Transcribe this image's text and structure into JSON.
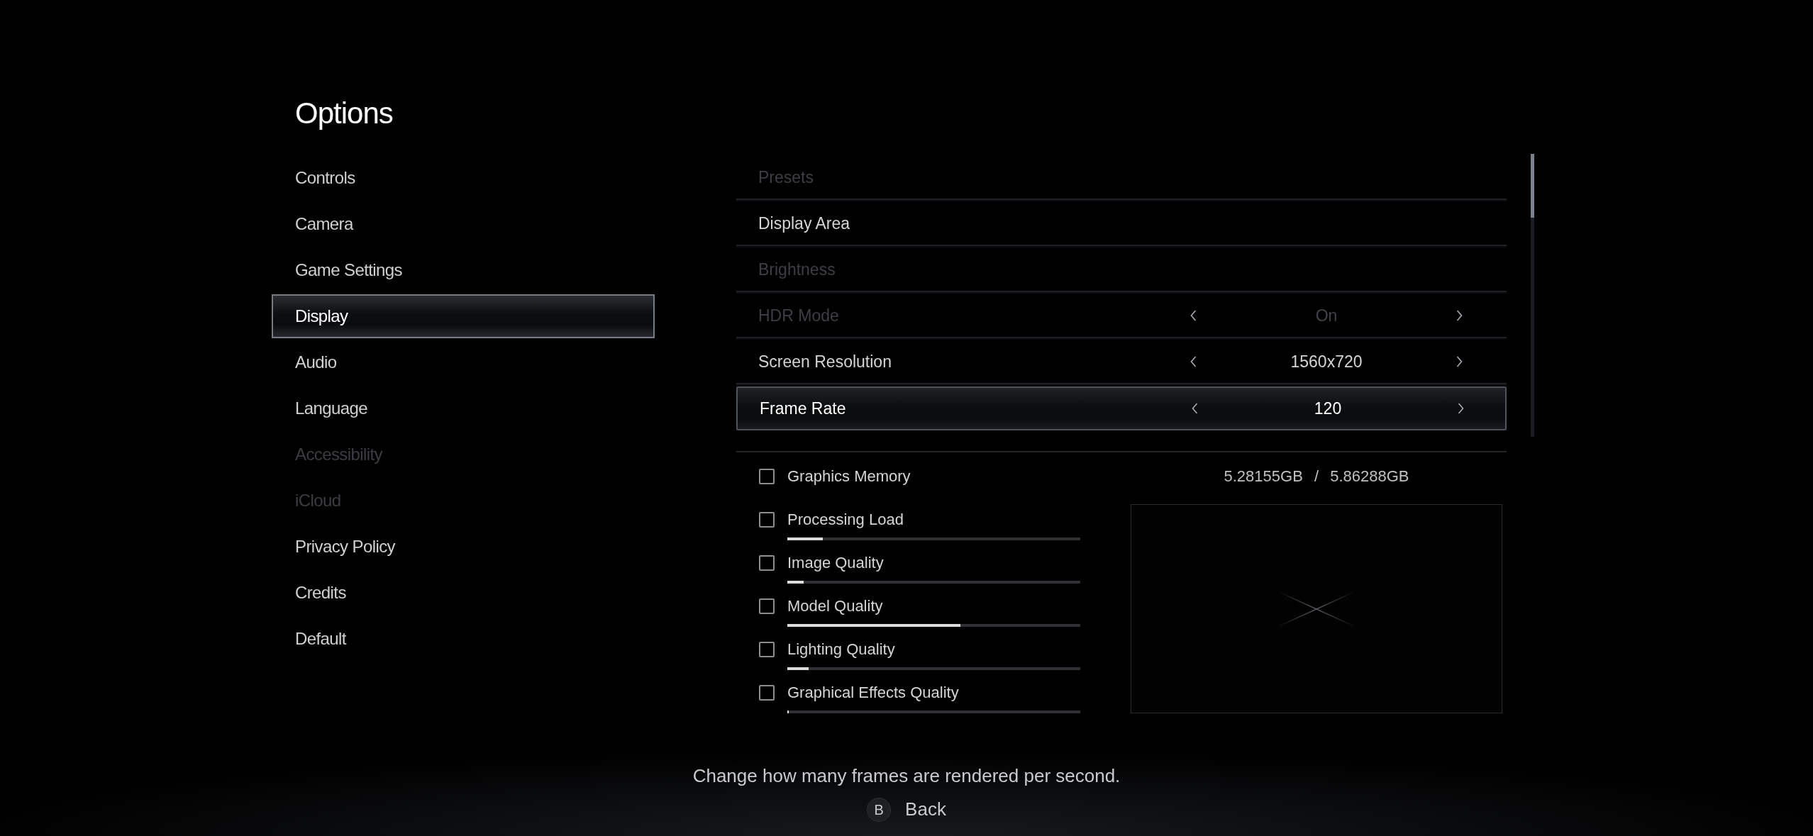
{
  "title": "Options",
  "menu": [
    {
      "label": "Controls",
      "selected": false,
      "disabled": false
    },
    {
      "label": "Camera",
      "selected": false,
      "disabled": false
    },
    {
      "label": "Game Settings",
      "selected": false,
      "disabled": false
    },
    {
      "label": "Display",
      "selected": true,
      "disabled": false
    },
    {
      "label": "Audio",
      "selected": false,
      "disabled": false
    },
    {
      "label": "Language",
      "selected": false,
      "disabled": false
    },
    {
      "label": "Accessibility",
      "selected": false,
      "disabled": true
    },
    {
      "label": "iCloud",
      "selected": false,
      "disabled": true
    },
    {
      "label": "Privacy Policy",
      "selected": false,
      "disabled": false
    },
    {
      "label": "Credits",
      "selected": false,
      "disabled": false
    },
    {
      "label": "Default",
      "selected": false,
      "disabled": false
    }
  ],
  "settings": [
    {
      "kind": "link",
      "label": "Presets",
      "selected": false,
      "disabled": true
    },
    {
      "kind": "link",
      "label": "Display Area",
      "selected": false,
      "disabled": false
    },
    {
      "kind": "link",
      "label": "Brightness",
      "selected": false,
      "disabled": true
    },
    {
      "kind": "selector",
      "label": "HDR Mode",
      "value": "On",
      "selected": false,
      "disabled": true
    },
    {
      "kind": "selector",
      "label": "Screen Resolution",
      "value": "1560x720",
      "selected": false,
      "disabled": false
    },
    {
      "kind": "selector",
      "label": "Frame Rate",
      "value": "120",
      "selected": true,
      "disabled": false
    }
  ],
  "monitor": {
    "items": [
      {
        "kind": "reading",
        "label": "Graphics Memory",
        "checked": false,
        "value": "5.28155GB / 5.86288GB"
      },
      {
        "kind": "meter",
        "label": "Processing Load",
        "checked": false,
        "level": 0.12
      },
      {
        "kind": "meter",
        "label": "Image Quality",
        "checked": false,
        "level": 0.056
      },
      {
        "kind": "meter",
        "label": "Model Quality",
        "checked": false,
        "level": 0.59
      },
      {
        "kind": "meter",
        "label": "Lighting Quality",
        "checked": false,
        "level": 0.073
      },
      {
        "kind": "meter",
        "label": "Graphical Effects Quality",
        "checked": false,
        "level": 0
      }
    ]
  },
  "footer": {
    "hint": "Change how many frames are rendered per second.",
    "back": {
      "key": "B",
      "label": "Back"
    }
  }
}
